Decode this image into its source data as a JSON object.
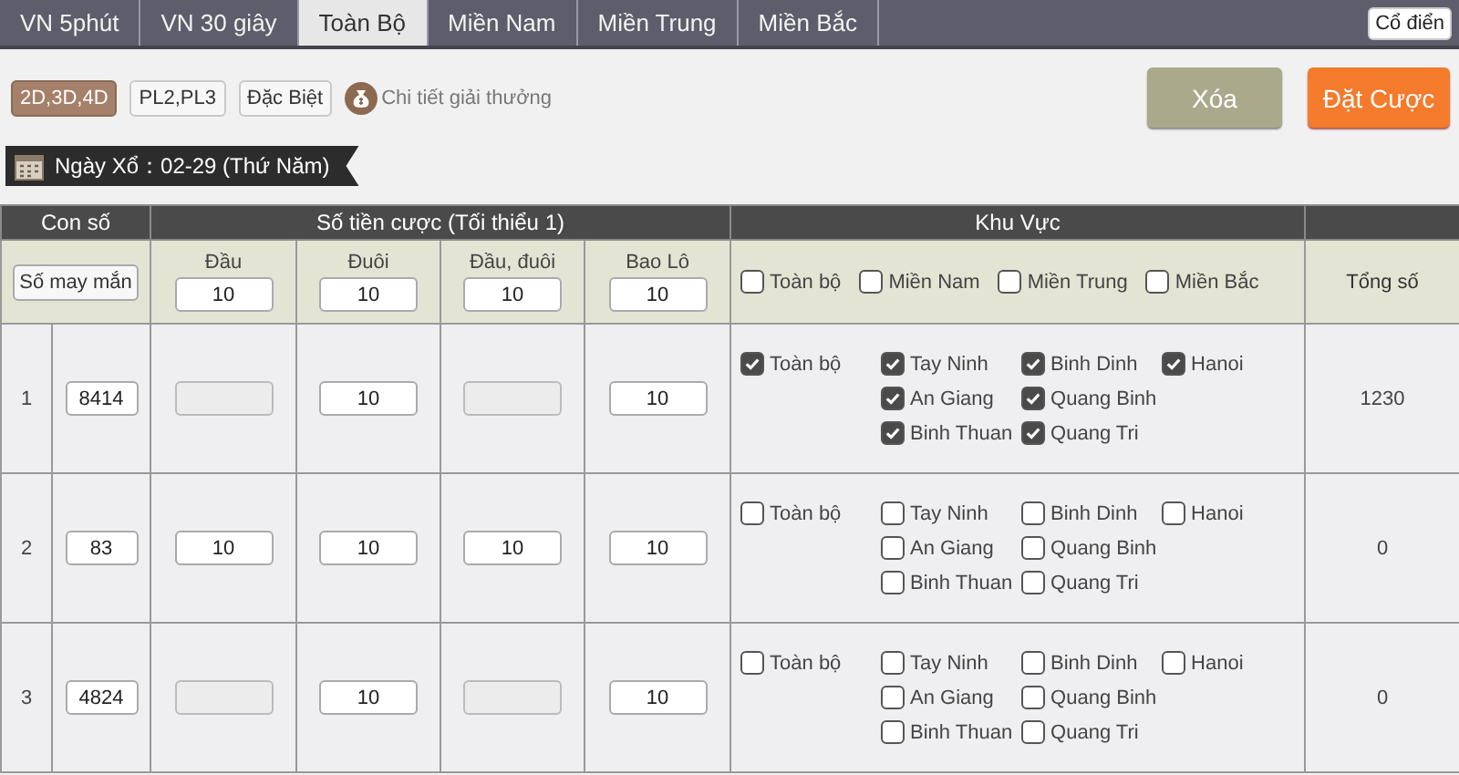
{
  "tabs": [
    {
      "label": "VN 5phút",
      "selected": false
    },
    {
      "label": "VN 30 giây",
      "selected": false
    },
    {
      "label": "Toàn Bộ",
      "selected": true
    },
    {
      "label": "Miền Nam",
      "selected": false
    },
    {
      "label": "Miền Trung",
      "selected": false
    },
    {
      "label": "Miền Bắc",
      "selected": false
    }
  ],
  "classic_button": "Cổ điển",
  "modes": [
    {
      "label": "2D,3D,4D",
      "selected": true
    },
    {
      "label": "PL2,PL3",
      "selected": false
    },
    {
      "label": "Đặc Biệt",
      "selected": false
    }
  ],
  "prize_link": "Chi tiết giải thưởng",
  "clear_button": "Xóa",
  "bet_button": "Đặt Cược",
  "draw_date": "Ngày Xổ：02-29 (Thứ Năm)",
  "table": {
    "group_headers": [
      "Con số",
      "Số tiền cược (Tối thiểu 1)",
      "Khu Vực"
    ],
    "lucky_button": "Số may mắn",
    "amount_columns": [
      {
        "label": "Đầu",
        "value": "10"
      },
      {
        "label": "Đuôi",
        "value": "10"
      },
      {
        "label": "Đầu, đuôi",
        "value": "10"
      },
      {
        "label": "Bao Lô",
        "value": "10"
      }
    ],
    "region_filters": [
      {
        "label": "Toàn bộ",
        "checked": false
      },
      {
        "label": "Miền Nam",
        "checked": false
      },
      {
        "label": "Miền Trung",
        "checked": false
      },
      {
        "label": "Miền Bắc",
        "checked": false
      }
    ],
    "total_header": "Tổng số",
    "rows": [
      {
        "index": "1",
        "number": "8414",
        "amounts": [
          {
            "disabled": true
          },
          {
            "value": "10",
            "disabled": false
          },
          {
            "disabled": true
          },
          {
            "value": "10",
            "disabled": false
          }
        ],
        "regions": [
          [
            {
              "label": "Toàn bộ",
              "checked": true
            }
          ],
          [
            {
              "label": "Tay Ninh",
              "checked": true
            },
            {
              "label": "An Giang",
              "checked": true
            },
            {
              "label": "Binh Thuan",
              "checked": true
            }
          ],
          [
            {
              "label": "Binh Dinh",
              "checked": true
            },
            {
              "label": "Quang Binh",
              "checked": true
            },
            {
              "label": "Quang Tri",
              "checked": true
            }
          ],
          [
            {
              "label": "Hanoi",
              "checked": true
            }
          ]
        ],
        "total": "1230"
      },
      {
        "index": "2",
        "number": "83",
        "amounts": [
          {
            "value": "10",
            "disabled": false
          },
          {
            "value": "10",
            "disabled": false
          },
          {
            "value": "10",
            "disabled": false
          },
          {
            "value": "10",
            "disabled": false
          }
        ],
        "regions": [
          [
            {
              "label": "Toàn bộ",
              "checked": false
            }
          ],
          [
            {
              "label": "Tay Ninh",
              "checked": false
            },
            {
              "label": "An Giang",
              "checked": false
            },
            {
              "label": "Binh Thuan",
              "checked": false
            }
          ],
          [
            {
              "label": "Binh Dinh",
              "checked": false
            },
            {
              "label": "Quang Binh",
              "checked": false
            },
            {
              "label": "Quang Tri",
              "checked": false
            }
          ],
          [
            {
              "label": "Hanoi",
              "checked": false
            }
          ]
        ],
        "total": "0"
      },
      {
        "index": "3",
        "number": "4824",
        "amounts": [
          {
            "disabled": true
          },
          {
            "value": "10",
            "disabled": false
          },
          {
            "disabled": true
          },
          {
            "value": "10",
            "disabled": false
          }
        ],
        "regions": [
          [
            {
              "label": "Toàn bộ",
              "checked": false
            }
          ],
          [
            {
              "label": "Tay Ninh",
              "checked": false
            },
            {
              "label": "An Giang",
              "checked": false
            },
            {
              "label": "Binh Thuan",
              "checked": false
            }
          ],
          [
            {
              "label": "Binh Dinh",
              "checked": false
            },
            {
              "label": "Quang Binh",
              "checked": false
            },
            {
              "label": "Quang Tri",
              "checked": false
            }
          ],
          [
            {
              "label": "Hanoi",
              "checked": false
            }
          ]
        ],
        "total": "0"
      }
    ]
  }
}
